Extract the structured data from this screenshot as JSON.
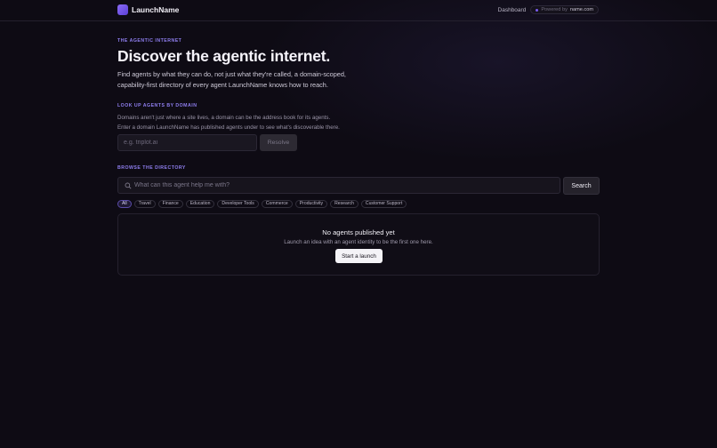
{
  "nav": {
    "brand": "LaunchName",
    "links": [
      "Dashboard"
    ],
    "powered_prefix": "Powered by",
    "powered_brand": "name.com"
  },
  "hero": {
    "eyebrow": "THE AGENTIC INTERNET",
    "title": "Discover the agentic internet.",
    "subtitle": "Find agents by what they can do, not just what they're called, a domain-scoped, capability-first directory of every agent LaunchName knows how to reach."
  },
  "domain_lookup": {
    "eyebrow": "LOOK UP AGENTS BY DOMAIN",
    "desc_line1": "Domains aren't just where a site lives, a domain can be the address book for its agents.",
    "desc_line2": "Enter a domain LaunchName has published agents under to see what's discoverable there.",
    "input_placeholder": "e.g. triplot.ai",
    "button_label": "Resolve"
  },
  "directory": {
    "eyebrow": "BROWSE THE DIRECTORY",
    "search_placeholder": "What can this agent help me with?",
    "search_button": "Search",
    "categories": [
      "All",
      "Travel",
      "Finance",
      "Education",
      "Developer Tools",
      "Commerce",
      "Productivity",
      "Research",
      "Customer Support"
    ],
    "active_category": "All",
    "empty_title": "No agents published yet",
    "empty_subtitle": "Launch an idea with an agent identity to be the first one here.",
    "empty_button": "Start a launch"
  },
  "colors": {
    "background": "#0e0b14",
    "accent": "#8f7ff0",
    "brand_gradient_start": "#8b6cf5",
    "brand_gradient_end": "#5b3fd6"
  },
  "icons": {
    "logo": "launchname-logo-icon",
    "search": "search-icon",
    "powered_dot": "status-dot-icon"
  }
}
